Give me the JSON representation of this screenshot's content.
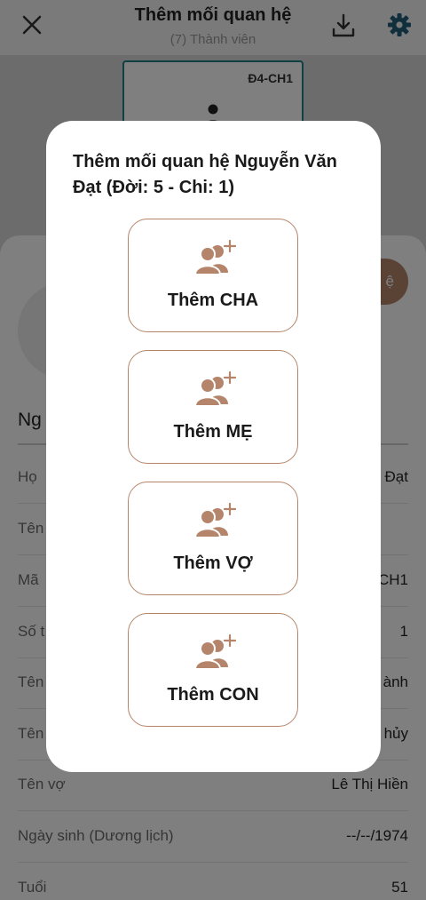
{
  "header": {
    "title": "Thêm mối quan hệ",
    "subtitle": "(7) Thành viên"
  },
  "tree": {
    "node_code": "Đ4-CH1"
  },
  "profile": {
    "add_relation_button_partial": "ệ",
    "name_partial": "Ng",
    "rows": [
      {
        "label": "Họ",
        "value": "Đạt"
      },
      {
        "label": "Tên",
        "value": ""
      },
      {
        "label": "Mã",
        "value": "CH1"
      },
      {
        "label": "Số t",
        "value": "1"
      },
      {
        "label": "Tên",
        "value": "ành"
      },
      {
        "label": "Tên",
        "value": "hủy"
      },
      {
        "label": "Tên vợ",
        "value": "Lê Thị Hiền"
      },
      {
        "label": "Ngày sinh (Dương lịch)",
        "value": "--/--/1974"
      },
      {
        "label": "Tuổi",
        "value": "51"
      }
    ]
  },
  "dialog": {
    "title": "Thêm mối quan hệ Nguyễn Văn Đạt (Đời: 5 - Chi: 1)",
    "buttons": [
      {
        "label": "Thêm CHA",
        "icon": "add-user-icon"
      },
      {
        "label": "Thêm MẸ",
        "icon": "add-user-icon"
      },
      {
        "label": "Thêm VỢ",
        "icon": "add-user-icon"
      },
      {
        "label": "Thêm CON",
        "icon": "add-user-icon"
      }
    ]
  },
  "colors": {
    "accent": "#b5856b",
    "node_border": "#1f7f86"
  }
}
